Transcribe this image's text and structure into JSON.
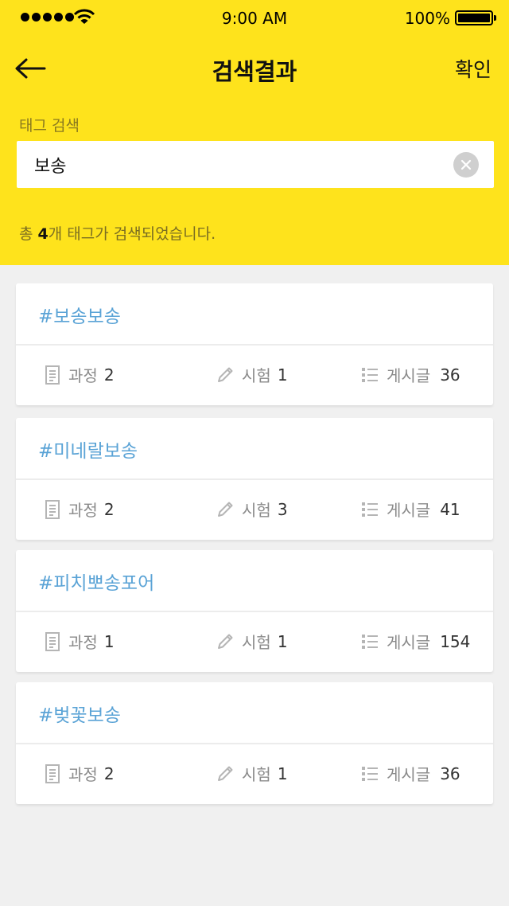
{
  "status_bar": {
    "time": "9:00 AM",
    "battery": "100%"
  },
  "nav": {
    "title": "검색결과",
    "confirm_label": "확인"
  },
  "search": {
    "label": "태그 검색",
    "value": "보송"
  },
  "result_summary": {
    "prefix": "총 ",
    "count": "4",
    "suffix": "개 태그가 검색되었습니다."
  },
  "stat_labels": {
    "course": "과정",
    "exam": "시험",
    "post": "게시글"
  },
  "tags": [
    {
      "name": "#보송보송",
      "course": "2",
      "exam": "1",
      "post": "36"
    },
    {
      "name": "#미네랄보송",
      "course": "2",
      "exam": "3",
      "post": "41"
    },
    {
      "name": "#피치뽀송포어",
      "course": "1",
      "exam": "1",
      "post": "154"
    },
    {
      "name": "#벚꽃보송",
      "course": "2",
      "exam": "1",
      "post": "36"
    }
  ],
  "colors": {
    "header_bg": "#fee31c",
    "tag_text": "#5aa3d6",
    "page_bg": "#f0f0f0"
  }
}
